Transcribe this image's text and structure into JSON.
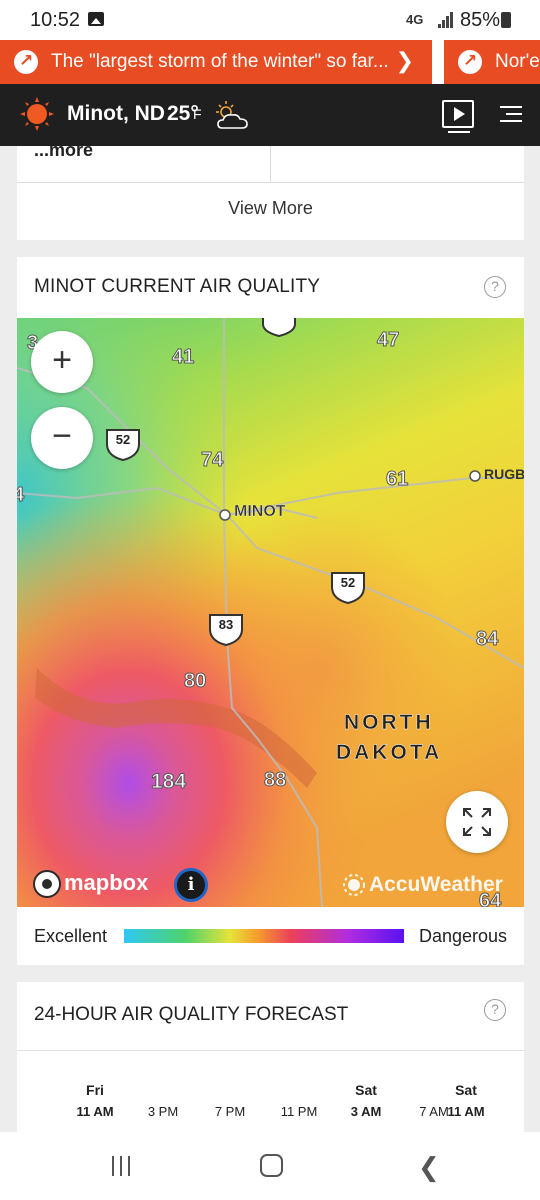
{
  "status_bar": {
    "time": "10:52",
    "network": "4G",
    "battery": "85%",
    "icons": [
      "gallery-icon",
      "signal-icon",
      "battery-icon"
    ]
  },
  "ticker": {
    "items": [
      {
        "text": "The \"largest storm of the winter\" so far...",
        "icon": "arrow-up-right-icon"
      },
      {
        "text": "Nor'ea",
        "icon": "arrow-up-right-icon"
      }
    ],
    "accent": "#e74c22"
  },
  "header": {
    "location": "Minot, ND",
    "temperature": "25°",
    "unit": "F",
    "weather_icon": "partly-cloudy-icon",
    "logo": "accuweather-sun-logo"
  },
  "top_card": {
    "more_text": "...more",
    "view_more": "View More"
  },
  "air_quality": {
    "title": "MINOT CURRENT AIR QUALITY",
    "help": "?",
    "map": {
      "cities": [
        {
          "name": "MINOT"
        },
        {
          "name": "RUGBY"
        }
      ],
      "state_label_line1": "NORTH",
      "state_label_line2": "DAKOTA",
      "route_shields": [
        "52",
        "52",
        "83"
      ],
      "road_numbers": [
        "41",
        "47",
        "74",
        "61",
        "84",
        "80",
        "88",
        "184",
        "64",
        "3",
        "4"
      ],
      "attribution": "mapbox",
      "provider": "AccuWeather"
    },
    "legend": {
      "low": "Excellent",
      "high": "Dangerous"
    }
  },
  "forecast": {
    "title": "24-HOUR AIR QUALITY FORECAST",
    "help": "?",
    "slots": [
      {
        "day": "Fri",
        "time": "11 AM",
        "bold": true
      },
      {
        "day": "",
        "time": "3 PM",
        "bold": false
      },
      {
        "day": "",
        "time": "7 PM",
        "bold": false
      },
      {
        "day": "",
        "time": "11 PM",
        "bold": false
      },
      {
        "day": "Sat",
        "time": "3 AM",
        "bold": true
      },
      {
        "day": "",
        "time": "7 AM",
        "bold": false
      },
      {
        "day": "Sat",
        "time": "11 AM",
        "bold": true
      }
    ]
  }
}
